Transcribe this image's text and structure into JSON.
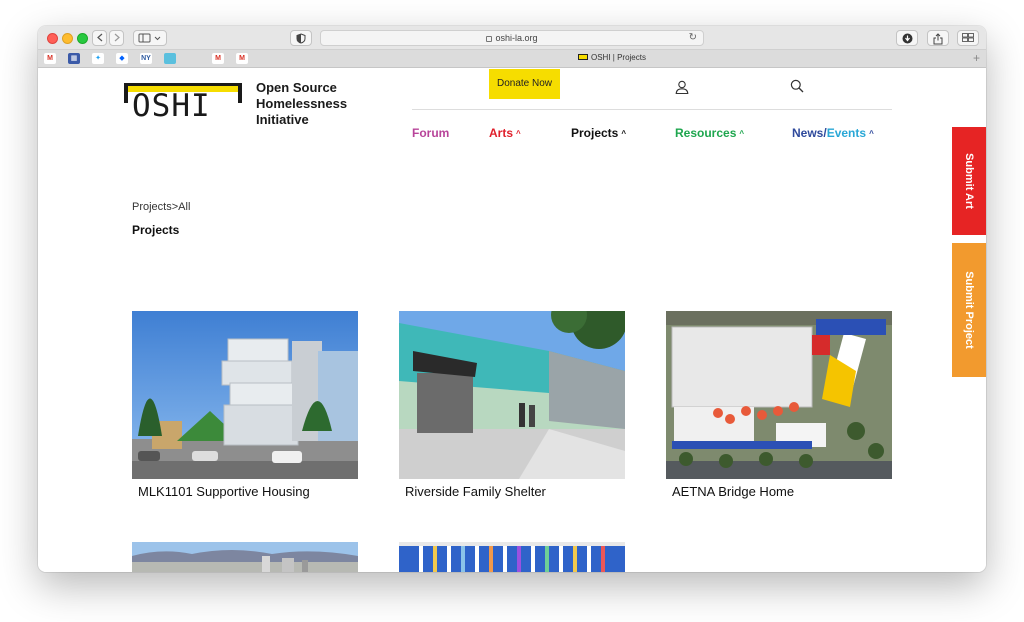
{
  "browser": {
    "url": "oshi-la.org",
    "tab_title": "OSHI | Projects"
  },
  "header": {
    "logo_text": "OSHI",
    "org_line1": "Open Source",
    "org_line2": "Homelessness",
    "org_line3": "Initiative",
    "donate_label": "Donate Now"
  },
  "nav": {
    "forum": "Forum",
    "arts": "Arts",
    "projects": "Projects",
    "resources": "Resources",
    "news": "News",
    "slash": "/",
    "events": "Events",
    "chevron": "^"
  },
  "colors": {
    "brand_yellow": "#f6dd00",
    "forum": "#b8449a",
    "arts": "#e0202c",
    "projects": "#111111",
    "resources": "#1ea64e",
    "news": "#2f4a9c",
    "events": "#29a7d6",
    "submit_art": "#e62424",
    "submit_project": "#f29a2e"
  },
  "breadcrumb": "Projects>All",
  "page_title": "Projects",
  "projects": [
    {
      "title": "MLK1101 Supportive Housing"
    },
    {
      "title": "Riverside Family Shelter"
    },
    {
      "title": "AETNA Bridge Home"
    }
  ],
  "side_tabs": {
    "submit_art": "Submit Art",
    "submit_project": "Submit Project"
  }
}
